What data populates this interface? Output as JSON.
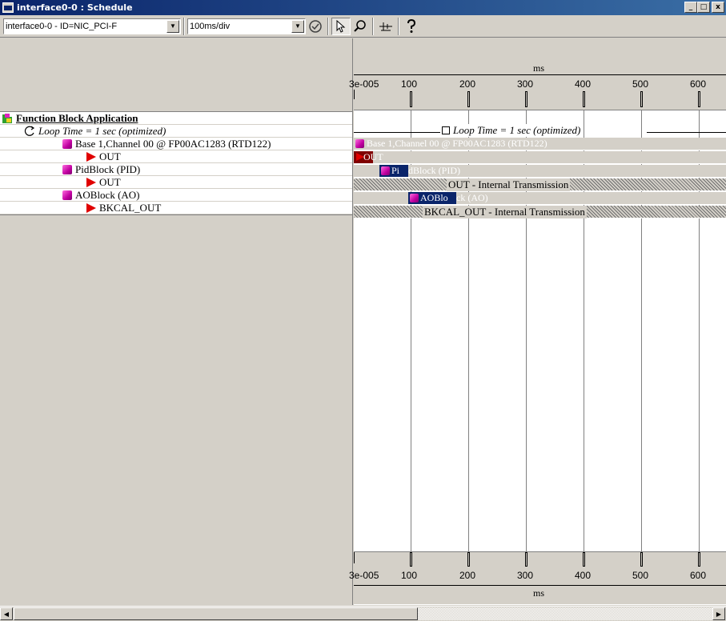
{
  "window": {
    "title": "interface0-0 : Schedule",
    "min_glyph": "_",
    "max_glyph": "□",
    "close_glyph": "x"
  },
  "toolbar": {
    "interface_select": "interface0-0 - ID=NIC_PCI-F",
    "scale_select": "100ms/div",
    "icons": [
      "verify-icon",
      "pointer-icon",
      "zoom-icon",
      "split-icon",
      "help-icon"
    ]
  },
  "ruler": {
    "unit": "ms",
    "origin_label": "3e-005",
    "ticks": [
      "100",
      "200",
      "300",
      "400",
      "500",
      "600"
    ]
  },
  "tree": {
    "root": "Function Block Application",
    "loop_time": "Loop Time = 1 sec (optimized)",
    "items": [
      {
        "label": "Base 1,Channel 00 @ FP00AC1283 (RTD122)",
        "kind": "block"
      },
      {
        "label": "OUT",
        "kind": "output"
      },
      {
        "label": "PidBlock (PID)",
        "kind": "block"
      },
      {
        "label": "OUT",
        "kind": "output"
      },
      {
        "label": "AOBlock (AO)",
        "kind": "block"
      },
      {
        "label": "BKCAL_OUT",
        "kind": "output"
      }
    ]
  },
  "gantt": {
    "loop_label": "Loop Time = 1 sec (optimized)",
    "base_label": "Base 1,Channel 00 @ FP00AC1283 (RTD122)",
    "base_out": "OUT",
    "pid_prefix": "Pi",
    "pid_label": "dBlock (PID)",
    "pid_out": "OUT - Internal Transmission",
    "ao_prefix": "AOBlo",
    "ao_label": "ck (AO)",
    "ao_out": "BKCAL_OUT - Internal Transmission"
  },
  "colors": {
    "titlebar_start": "#0a246a",
    "titlebar_end": "#3a6ea5",
    "block_fill": "#0a246a",
    "output_marker": "#e00000",
    "block_icon": "#c000a0"
  }
}
